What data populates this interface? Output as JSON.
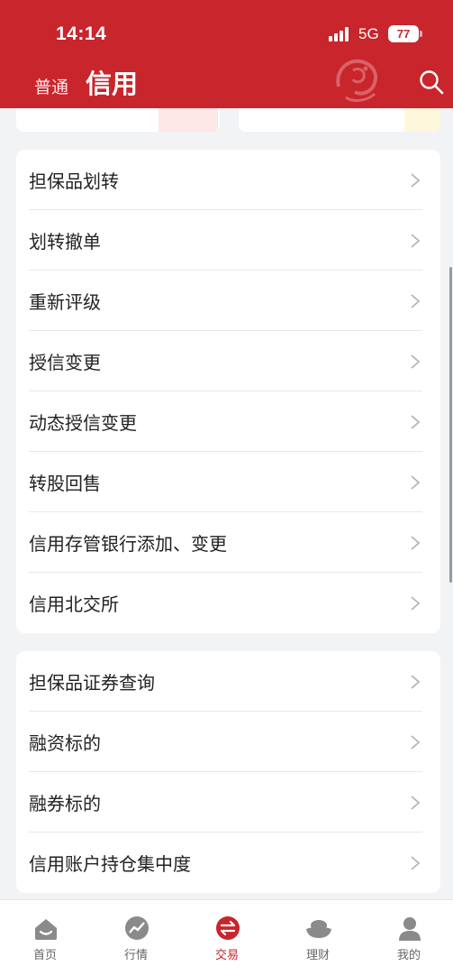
{
  "status": {
    "time": "14:14",
    "network": "5G",
    "battery": "77"
  },
  "header": {
    "tab_normal": "普通",
    "tab_credit": "信用",
    "accent": "#c9252c"
  },
  "section1": {
    "items": [
      {
        "label": "担保品划转"
      },
      {
        "label": "划转撤单"
      },
      {
        "label": "重新评级"
      },
      {
        "label": "授信变更"
      },
      {
        "label": "动态授信变更"
      },
      {
        "label": "转股回售"
      },
      {
        "label": "信用存管银行添加、变更"
      },
      {
        "label": "信用北交所"
      }
    ]
  },
  "section2": {
    "items": [
      {
        "label": "担保品证券查询"
      },
      {
        "label": "融资标的"
      },
      {
        "label": "融券标的"
      },
      {
        "label": "信用账户持仓集中度"
      }
    ]
  },
  "bottom_nav": {
    "items": [
      {
        "label": "首页",
        "icon": "home-icon"
      },
      {
        "label": "行情",
        "icon": "market-chart-icon"
      },
      {
        "label": "交易",
        "icon": "trade-exchange-icon",
        "active": true
      },
      {
        "label": "理财",
        "icon": "wealth-ingot-icon"
      },
      {
        "label": "我的",
        "icon": "profile-icon"
      }
    ]
  }
}
